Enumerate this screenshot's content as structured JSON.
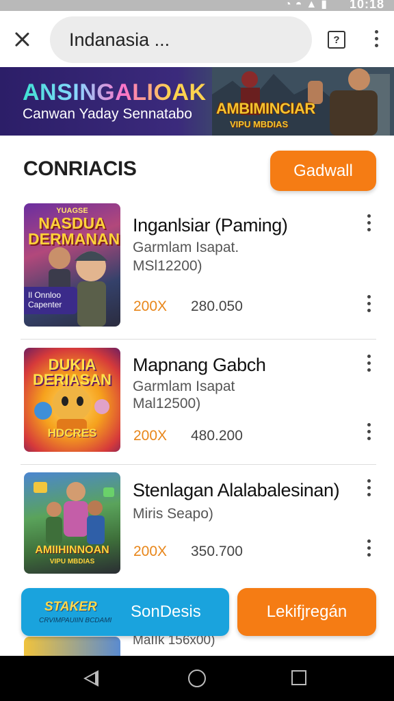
{
  "status_bar": {
    "time": "10:18",
    "icons": [
      "wifi-icon",
      "signal-icon",
      "battery-icon"
    ]
  },
  "app_bar": {
    "url_text": "Indanasia ...",
    "help_label": "?"
  },
  "banner": {
    "title": "ANSINGALIOAK",
    "subtitle": "Canwan Yaday Sennatabo",
    "art_logo": "AMBIMINCIAR",
    "art_logo_sub": "VIPU MBDIAS"
  },
  "section": {
    "title": "CONRIACIS",
    "action_label": "Gadwall"
  },
  "items": [
    {
      "title": "Inganlsiar (Paming)",
      "sub1": "Garmlam Isapat.",
      "sub2": "MSl12200)",
      "multiplier": "200X",
      "price": "280.050",
      "thumb_title": "NASDUA DERMANAN",
      "thumb_small": "YUAGSE",
      "thumb_badge": "Il Onnloo Capenter"
    },
    {
      "title": "Mapnang Gabch",
      "sub1": "Garmlam Isapat",
      "sub2": "Mal12500)",
      "multiplier": "200X",
      "price": "480.200",
      "thumb_title": "DUKIA DERIASAN",
      "thumb_small": "HDCRES"
    },
    {
      "title": "Stenlagan Alalabalesinan)",
      "sub1": "Miris Seapo)",
      "sub2": "",
      "multiplier": "200X",
      "price": "350.700",
      "thumb_title": "AMIIHINNOAN",
      "thumb_small": "VIPU MBDIAS"
    }
  ],
  "bottom_actions": {
    "staker_logo": "STAKER",
    "staker_sub": "CRVIMPAUIIN BCDAMI",
    "blue_label": "SonDesis",
    "orange_label": "Lekifjregán"
  },
  "peek_item": {
    "sub": "MaIIk 156x00)"
  },
  "colors": {
    "accent_orange": "#f57c14",
    "accent_blue": "#1aa3dd",
    "multiplier": "#e8861a"
  }
}
